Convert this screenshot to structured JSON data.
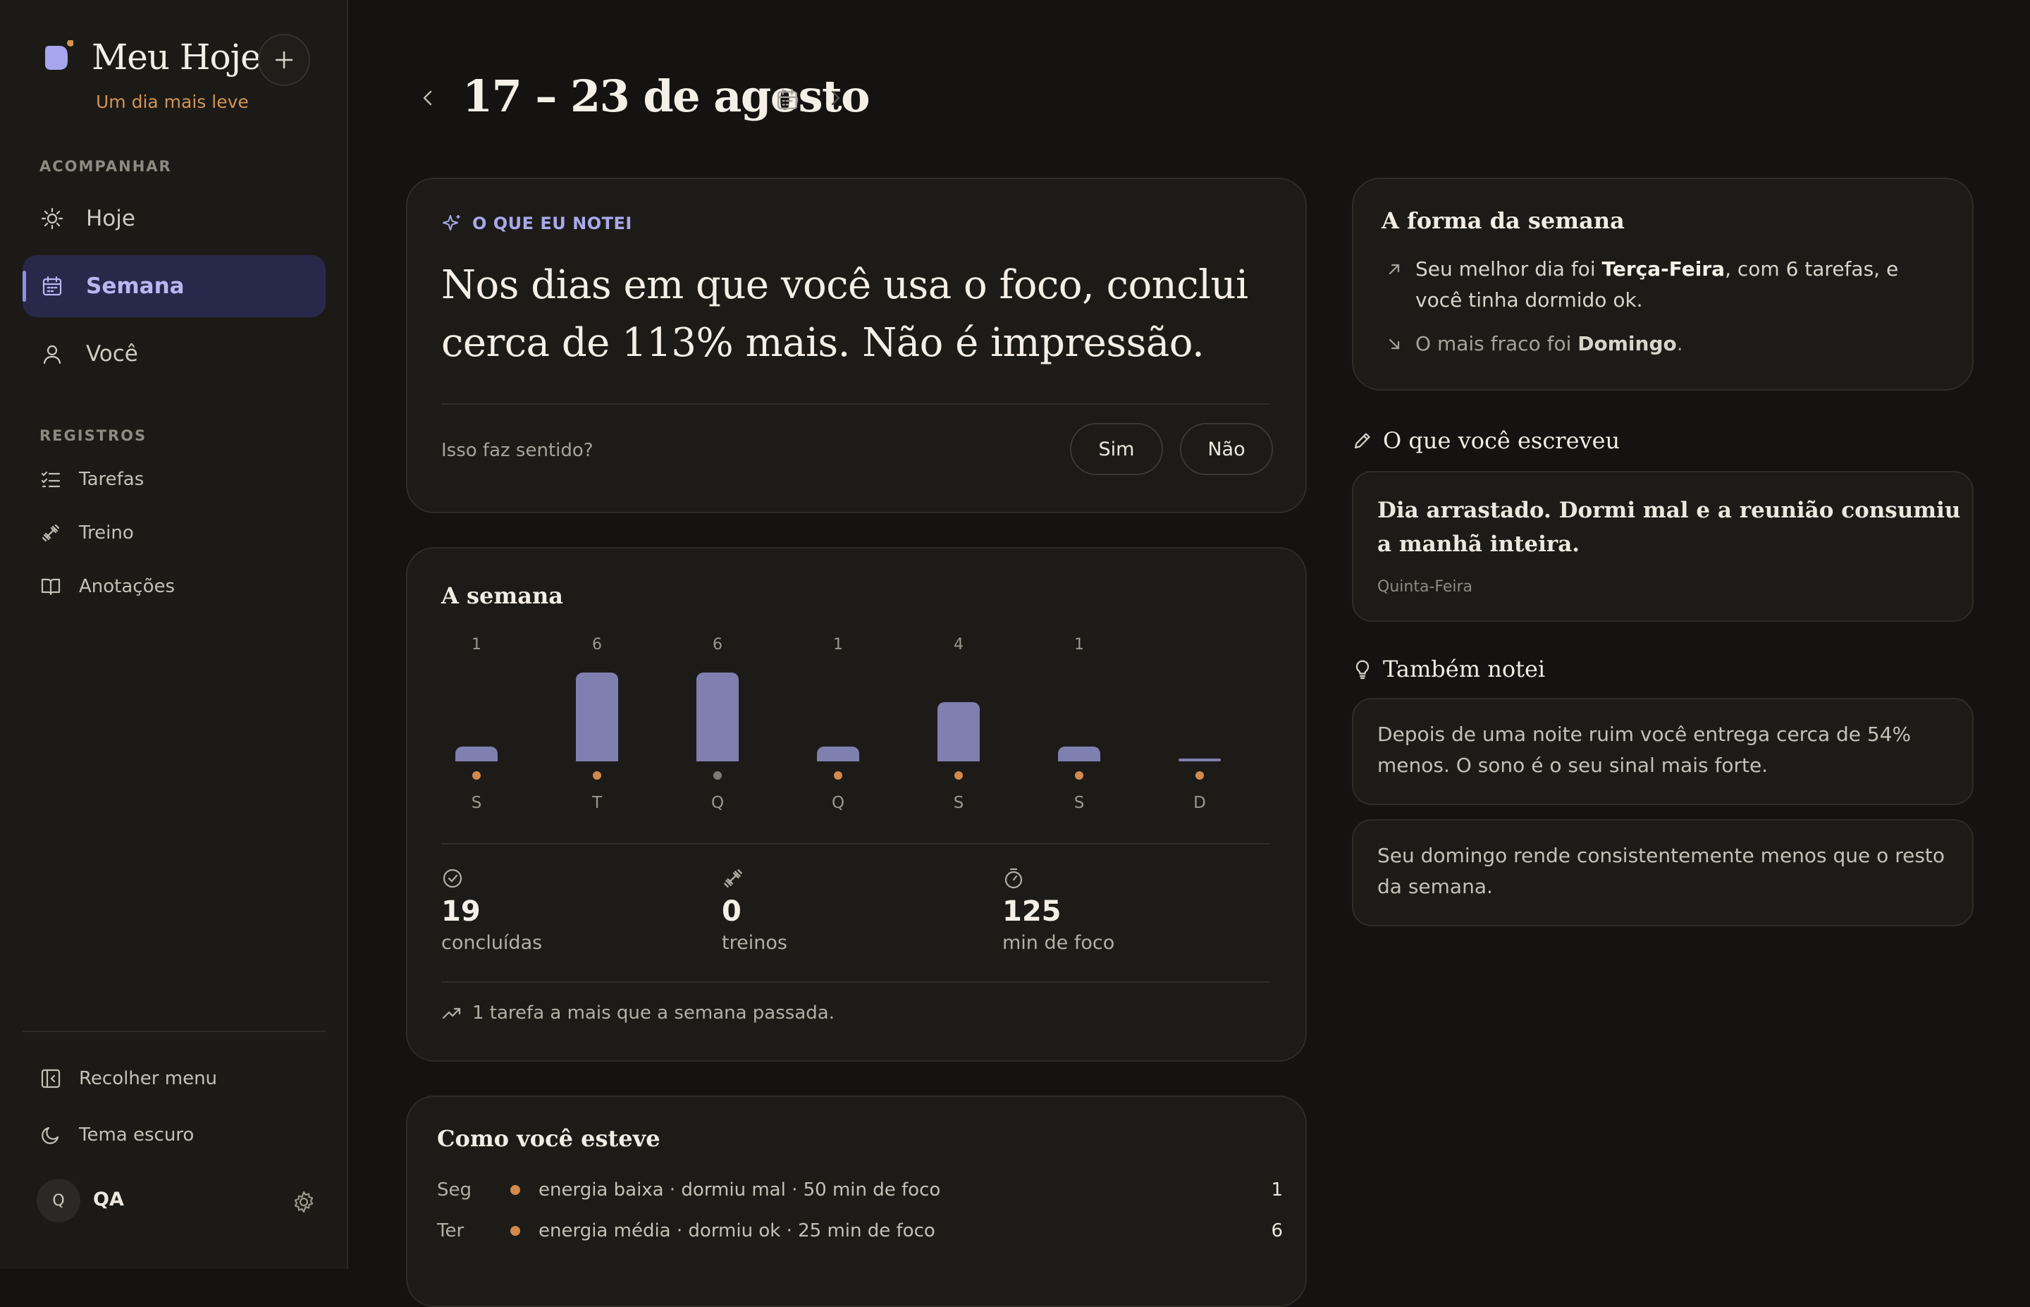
{
  "brand": {
    "title": "Meu Hoje",
    "tagline": "Um dia mais leve",
    "accent": "#8f8ee8",
    "dot_color": "#d39353"
  },
  "sidebar": {
    "section_follow": "ACOMPANHAR",
    "nav": [
      {
        "label": "Hoje",
        "icon": "sun-icon"
      },
      {
        "label": "Semana",
        "icon": "calendar-icon",
        "active": true
      },
      {
        "label": "Você",
        "icon": "user-icon"
      }
    ],
    "section_records": "REGISTROS",
    "records": [
      {
        "label": "Tarefas",
        "icon": "checklist-icon"
      },
      {
        "label": "Treino",
        "icon": "dumbbell-icon"
      },
      {
        "label": "Anotações",
        "icon": "book-icon"
      }
    ],
    "collapse_label": "Recolher menu",
    "theme_label": "Tema escuro",
    "user": {
      "initial": "Q",
      "name": "QA"
    }
  },
  "header": {
    "title": "17 – 23 de agosto"
  },
  "insight": {
    "label": "O QUE EU NOTEI",
    "text": "Nos dias em que você usa o foco, conclui cerca de 113% mais. Não é impressão.",
    "question": "Isso faz sentido?",
    "yes_label": "Sim",
    "no_label": "Não"
  },
  "week": {
    "title": "A semana",
    "stats": [
      {
        "icon": "check-circle-icon",
        "value": "19",
        "label": "concluídas"
      },
      {
        "icon": "dumbbell-icon",
        "value": "0",
        "label": "treinos"
      },
      {
        "icon": "timer-icon",
        "value": "125",
        "label": "min de foco"
      }
    ],
    "trend": "1 tarefa a mais que a semana passada."
  },
  "chart_data": {
    "type": "bar",
    "categories": [
      "S",
      "T",
      "Q",
      "Q",
      "S",
      "S",
      "D"
    ],
    "values": [
      1,
      6,
      6,
      1,
      4,
      1,
      0
    ],
    "value_labels": [
      "1",
      "6",
      "6",
      "1",
      "4",
      "1",
      ""
    ],
    "dot_colors": [
      "#d18a4b",
      "#d18a4b",
      "#7e7b75",
      "#d18a4b",
      "#d18a4b",
      "#d18a4b",
      "#d18a4b"
    ],
    "bar_color": "#7f7fb0",
    "ylim": [
      0,
      6
    ]
  },
  "mood": {
    "title": "Como você esteve",
    "rows": [
      {
        "day": "Seg",
        "text": "energia baixa · dormiu mal · 50 min de foco",
        "count": "1"
      },
      {
        "day": "Ter",
        "text": "energia média · dormiu ok · 25 min de foco",
        "count": "6"
      }
    ]
  },
  "shape": {
    "title": "A forma da semana",
    "best_prefix": "Seu melhor dia foi ",
    "best_day": "Terça-Feira",
    "best_suffix": ", com 6 tarefas, e você tinha dormido ok.",
    "worst_prefix": "O mais fraco foi ",
    "worst_day": "Domingo",
    "worst_suffix": "."
  },
  "wrote": {
    "title": "O que você escreveu",
    "text": "Dia arrastado. Dormi mal e a reunião consumiu a manhã inteira.",
    "day": "Quinta-Feira"
  },
  "also": {
    "title": "Também notei",
    "items": [
      "Depois de uma noite ruim você entrega cerca de 54% menos. O sono é o seu sinal mais forte.",
      "Seu domingo rende consistentemente menos que o resto da semana."
    ]
  }
}
